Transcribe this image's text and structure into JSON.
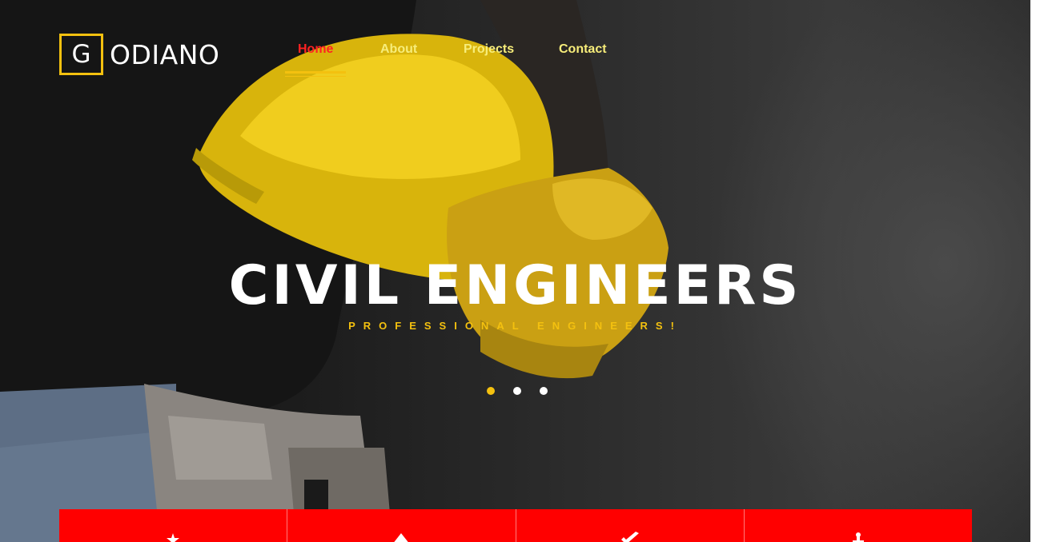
{
  "logo": {
    "letter": "G",
    "rest": "ODIANO"
  },
  "nav": {
    "items": [
      {
        "label": "Home",
        "active": true
      },
      {
        "label": "About",
        "active": false
      },
      {
        "label": "Projects",
        "active": false
      },
      {
        "label": "Contact",
        "active": false
      }
    ]
  },
  "hero": {
    "title": "CIVIL ENGINEERS",
    "subtitle": "PROFESSIONAL ENGINEERS!",
    "slides_total": 3,
    "active_slide": 1
  },
  "features": {
    "icons": [
      "tools-icon",
      "warning-icon",
      "wrench-icon",
      "crane-icon"
    ]
  },
  "colors": {
    "accent": "#f4c10f",
    "nav_active": "#ff2222",
    "nav_text": "#f7ed7a",
    "feature_bar": "#ff0000"
  }
}
